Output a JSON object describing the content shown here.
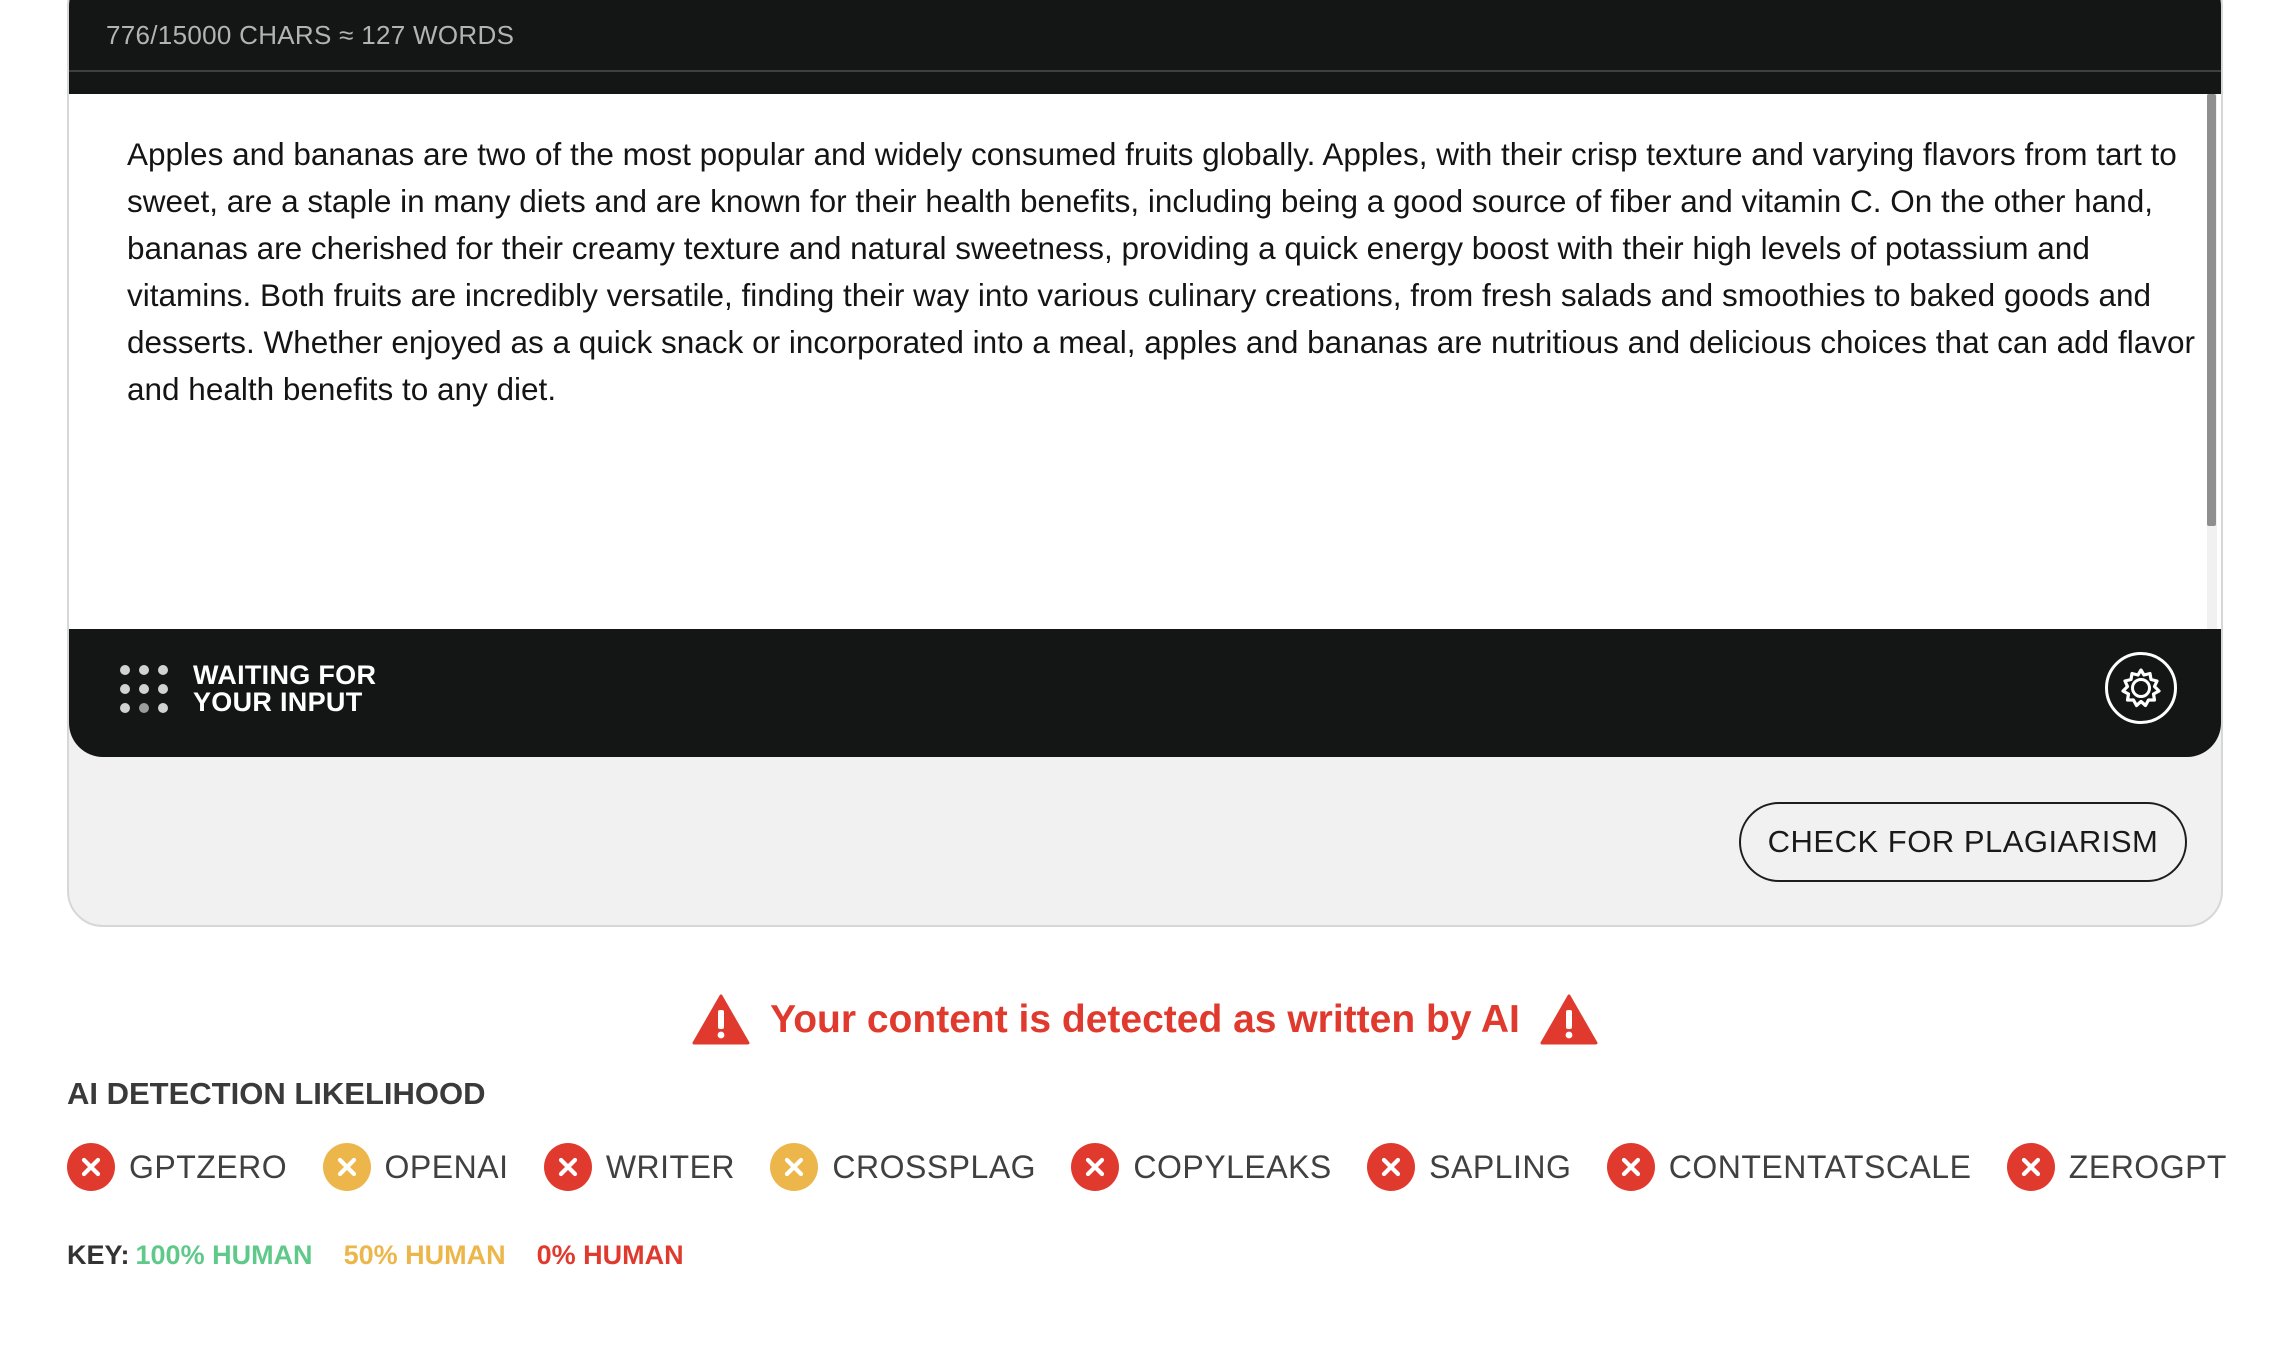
{
  "editor": {
    "counter": "776/15000 CHARS ≈ 127 WORDS",
    "text": "Apples and bananas are two of the most popular and widely consumed fruits globally. Apples, with their crisp texture and varying flavors from tart to sweet, are a staple in many diets and are known for their health benefits, including being a good source of fiber and vitamin C. On the other hand, bananas are cherished for their creamy texture and natural sweetness, providing a quick energy boost with their high levels of potassium and vitamins. Both fruits are incredibly versatile, finding their way into various culinary creations, from fresh salads and smoothies to baked goods and desserts. Whether enjoyed as a quick snack or incorporated into a meal, apples and bananas are nutritious and delicious choices that can add flavor and health benefits to any diet.",
    "status_line1": "WAITING FOR",
    "status_line2": "YOUR INPUT",
    "settings_icon": "gear-icon"
  },
  "actions": {
    "plagiarism_button": "CHECK FOR PLAGIARISM"
  },
  "result": {
    "alert": "Your content is detected as written by AI",
    "alert_icon": "warning-triangle-icon",
    "alert_color": "#e03a2f"
  },
  "likelihood": {
    "title": "AI DETECTION LIKELIHOOD",
    "detectors": [
      {
        "name": "GPTZERO",
        "status": "ai",
        "color": "#e03a2f"
      },
      {
        "name": "OPENAI",
        "status": "mixed",
        "color": "#ecb64a"
      },
      {
        "name": "WRITER",
        "status": "ai",
        "color": "#e03a2f"
      },
      {
        "name": "CROSSPLAG",
        "status": "mixed",
        "color": "#ecb64a"
      },
      {
        "name": "COPYLEAKS",
        "status": "ai",
        "color": "#e03a2f"
      },
      {
        "name": "SAPLING",
        "status": "ai",
        "color": "#e03a2f"
      },
      {
        "name": "CONTENTATSCALE",
        "status": "ai",
        "color": "#e03a2f"
      },
      {
        "name": "ZEROGPT",
        "status": "ai",
        "color": "#e03a2f"
      }
    ]
  },
  "key": {
    "label": "KEY:",
    "human": "100% HUMAN",
    "half": "50% HUMAN",
    "zero": "0% HUMAN",
    "human_color": "#5fc98a",
    "half_color": "#ecb64a",
    "zero_color": "#e03a2f"
  }
}
